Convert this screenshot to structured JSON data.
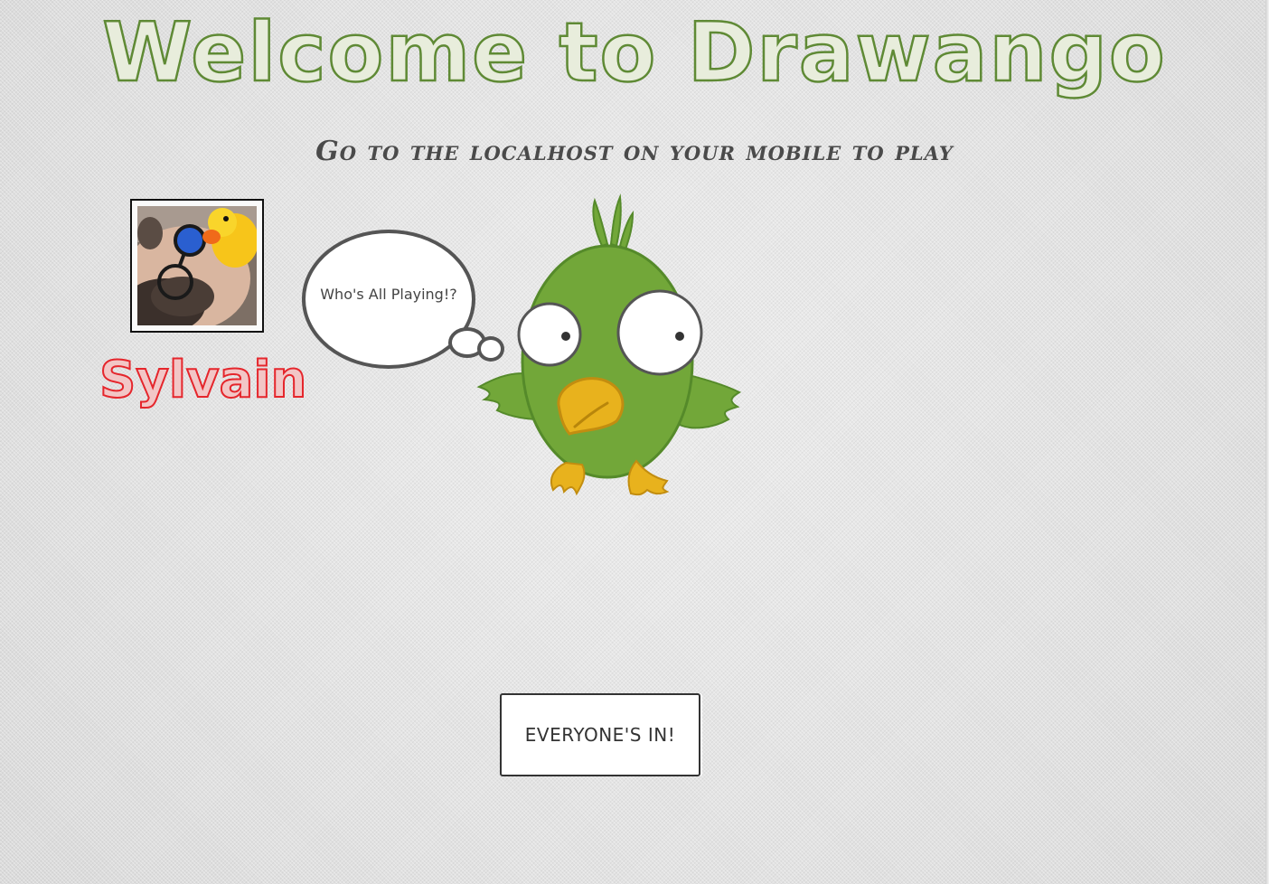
{
  "header": {
    "title": "Welcome to Drawango"
  },
  "instructions": {
    "text": "Go to the localhost on your mobile to play"
  },
  "players": [
    {
      "name": "Sylvain",
      "avatar": "player-photo"
    }
  ],
  "mascot": {
    "thought": "Who's All Playing!?",
    "icon": "green-bird-mascot"
  },
  "actions": {
    "ready_label": "EVERYONE'S IN!"
  },
  "colors": {
    "title": "#5f8a35",
    "player_name": "#e5262c",
    "bird_body": "#72a739",
    "bird_beak": "#e8b21d"
  }
}
